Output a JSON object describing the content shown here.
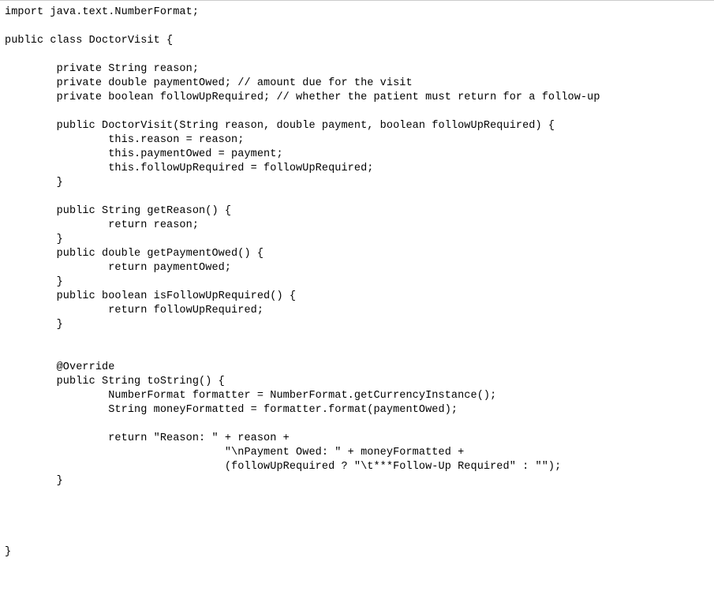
{
  "code": {
    "lines": [
      "import java.text.NumberFormat;",
      "",
      "public class DoctorVisit {",
      "",
      "        private String reason;",
      "        private double paymentOwed; // amount due for the visit",
      "        private boolean followUpRequired; // whether the patient must return for a follow-up",
      "",
      "        public DoctorVisit(String reason, double payment, boolean followUpRequired) {",
      "                this.reason = reason;",
      "                this.paymentOwed = payment;",
      "                this.followUpRequired = followUpRequired;",
      "        }",
      "",
      "        public String getReason() {",
      "                return reason;",
      "        }",
      "        public double getPaymentOwed() {",
      "                return paymentOwed;",
      "        }",
      "        public boolean isFollowUpRequired() {",
      "                return followUpRequired;",
      "        }",
      "",
      "",
      "        @Override",
      "        public String toString() {",
      "                NumberFormat formatter = NumberFormat.getCurrencyInstance();",
      "                String moneyFormatted = formatter.format(paymentOwed);",
      "",
      "                return \"Reason: \" + reason +",
      "                                  \"\\nPayment Owed: \" + moneyFormatted +",
      "                                  (followUpRequired ? \"\\t***Follow-Up Required\" : \"\");",
      "        }",
      "",
      "",
      "",
      "",
      "}"
    ]
  }
}
